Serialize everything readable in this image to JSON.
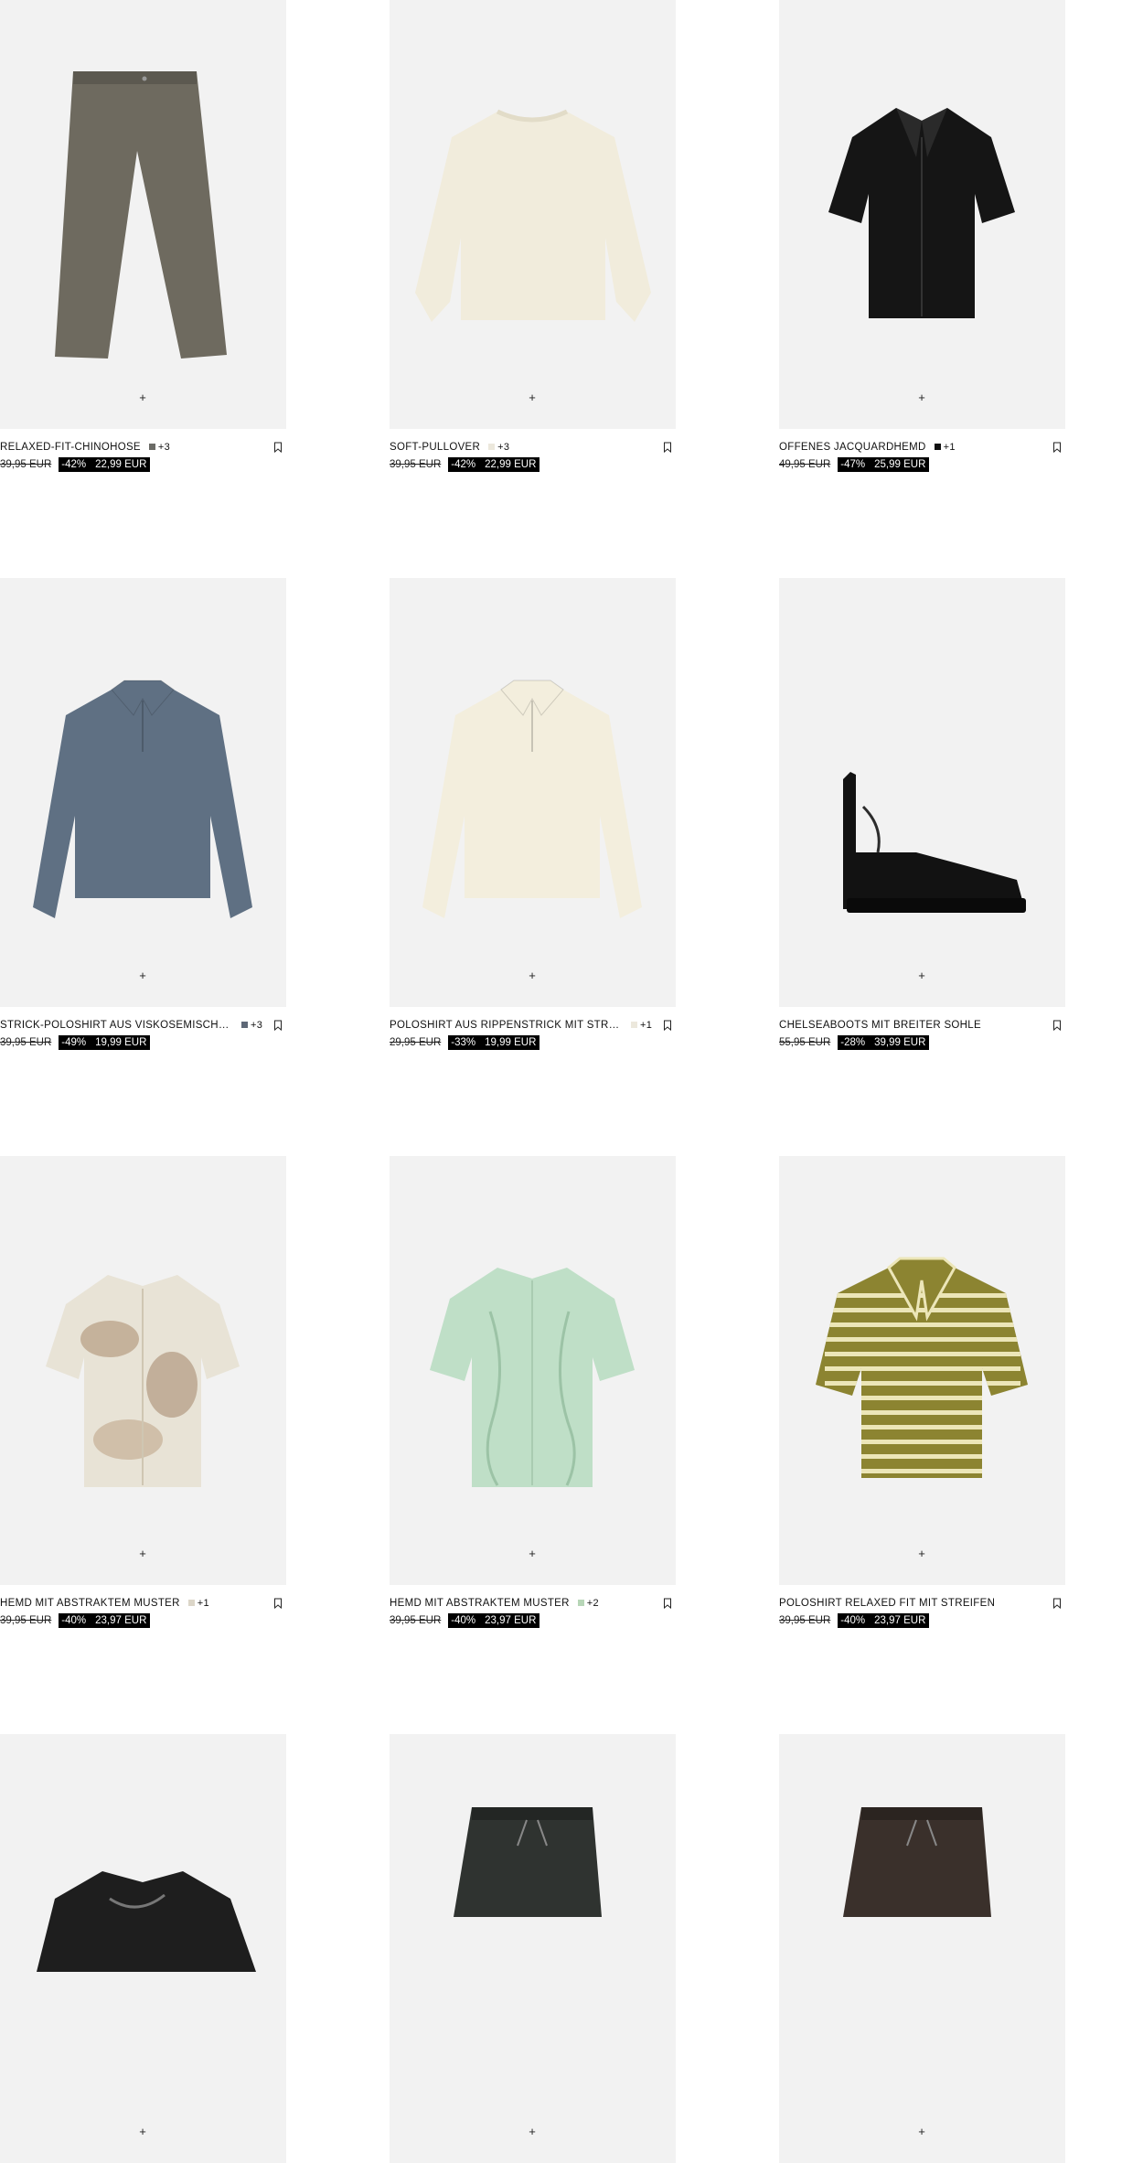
{
  "colors": {
    "image_bg": "#f2f2f2",
    "sale_bg": "#000000",
    "sale_text": "#ffffff"
  },
  "icons": {
    "add": "+",
    "bookmark": "bookmark-icon"
  },
  "products": [
    {
      "name": "RELAXED-FIT-CHINOHOSE",
      "swatch": "#6b6b66",
      "more": "+3",
      "old_price": "39,95 EUR",
      "discount": "-42%",
      "price": "22,99 EUR",
      "art": "pants",
      "art_color": "#6e6a5f"
    },
    {
      "name": "SOFT-PULLOVER",
      "swatch": "#ece8dc",
      "more": "+3",
      "old_price": "39,95 EUR",
      "discount": "-42%",
      "price": "22,99 EUR",
      "art": "sweater",
      "art_color": "#f1ecdc"
    },
    {
      "name": "OFFENES JACQUARDHEMD",
      "swatch": "#111111",
      "more": "+1",
      "old_price": "49,95 EUR",
      "discount": "-47%",
      "price": "25,99 EUR",
      "art": "shirt",
      "art_color": "#151515"
    },
    {
      "name": "STRICK-POLOSHIRT AUS VISKOSEMISCHUNG",
      "swatch": "#5e6877",
      "more": "+3",
      "old_price": "39,95 EUR",
      "discount": "-49%",
      "price": "19,99 EUR",
      "art": "polo_long",
      "art_color": "#5f7083"
    },
    {
      "name": "POLOSHIRT AUS RIPPENSTRICK MIT STRUKTUR",
      "swatch": "#ece8dc",
      "more": "+1",
      "old_price": "29,95 EUR",
      "discount": "-33%",
      "price": "19,99 EUR",
      "art": "polo_long",
      "art_color": "#f3eedd"
    },
    {
      "name": "CHELSEABOOTS MIT BREITER SOHLE",
      "swatch": "",
      "more": "",
      "old_price": "55,95 EUR",
      "discount": "-28%",
      "price": "39,99 EUR",
      "art": "boot",
      "art_color": "#121212"
    },
    {
      "name": "HEMD MIT ABSTRAKTEM MUSTER",
      "swatch": "#dcd6c8",
      "more": "+1",
      "old_price": "39,95 EUR",
      "discount": "-40%",
      "price": "23,97 EUR",
      "art": "shirt_print",
      "art_color": "#e8e3d6"
    },
    {
      "name": "HEMD MIT ABSTRAKTEM MUSTER",
      "swatch": "#b7d6b7",
      "more": "+2",
      "old_price": "39,95 EUR",
      "discount": "-40%",
      "price": "23,97 EUR",
      "art": "shirt_green",
      "art_color": "#bfdfc7"
    },
    {
      "name": "POLOSHIRT RELAXED FIT MIT STREIFEN",
      "swatch": "",
      "more": "",
      "old_price": "39,95 EUR",
      "discount": "-40%",
      "price": "23,97 EUR",
      "art": "polo_stripe",
      "art_color": "#8c8431"
    },
    {
      "name": "",
      "swatch": "",
      "more": "",
      "old_price": "",
      "discount": "",
      "price": "",
      "art": "shirt_dark",
      "art_color": "#1e1e1e"
    },
    {
      "name": "",
      "swatch": "",
      "more": "",
      "old_price": "",
      "discount": "",
      "price": "",
      "art": "shorts",
      "art_color": "#2f3330"
    },
    {
      "name": "",
      "swatch": "",
      "more": "",
      "old_price": "",
      "discount": "",
      "price": "",
      "art": "shorts",
      "art_color": "#3a302b"
    }
  ]
}
